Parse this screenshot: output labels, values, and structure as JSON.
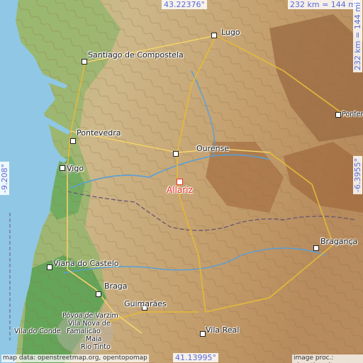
{
  "map": {
    "coords": {
      "top": "43.22376°",
      "bottom": "41.13995°",
      "left": "-9.208°",
      "right": "-6.3955°"
    },
    "scale_top": "232 km = 144 mi",
    "scale_right": "232 km = 144 mi",
    "credit_left": "map data: openstreetmap.org, opentopomap",
    "credit_right": "image proc.: elevation.city",
    "colors": {
      "sea": "#8fc7e4",
      "highlight": "#e8332b",
      "coord": "#5b6bd8"
    },
    "places": {
      "lugo": "Lugo",
      "santiago": "Santiago de Compostela",
      "ponferrada": "Ponfer",
      "pontevedra": "Pontevedra",
      "ourense": "Ourense",
      "vigo": "Vigo",
      "allariz": "Allariz",
      "braganca": "Bragança",
      "viana": "Viana do Castelo",
      "braga": "Braga",
      "guimaraes": "Guimarães",
      "povoa": "Póvoa de Varzim",
      "vila_nova": "Vila Nova de",
      "famalicao": "Famalicão",
      "vila_conde": "Vila do Conde",
      "maia": "Maia",
      "rio_tinto": "Rio Tinto",
      "vila_real": "Vila Real"
    }
  }
}
